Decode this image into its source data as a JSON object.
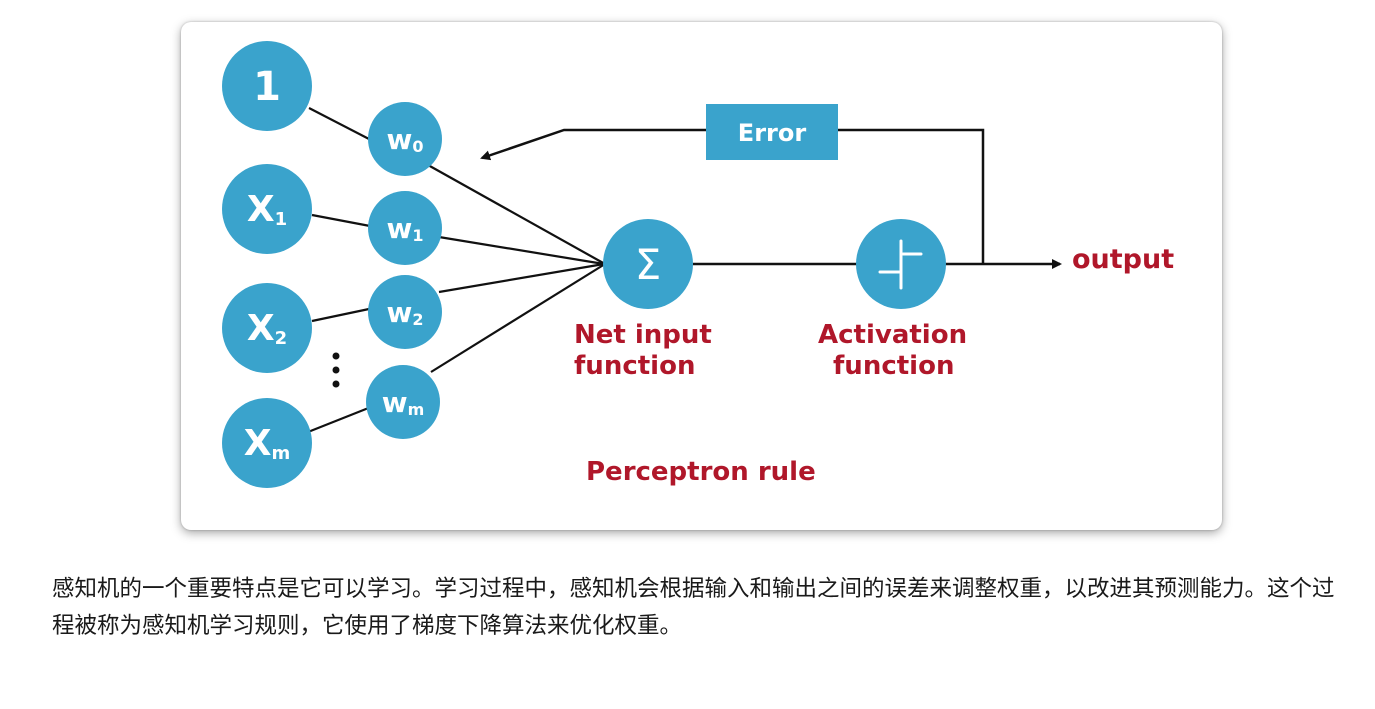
{
  "diagram": {
    "inputs": [
      {
        "id": "bias",
        "main": "1",
        "sub": ""
      },
      {
        "id": "x1",
        "main": "X",
        "sub": "1"
      },
      {
        "id": "x2",
        "main": "X",
        "sub": "2"
      },
      {
        "id": "xm",
        "main": "X",
        "sub": "m"
      }
    ],
    "weights": [
      {
        "id": "w0",
        "main": "w",
        "sub": "0"
      },
      {
        "id": "w1",
        "main": "w",
        "sub": "1"
      },
      {
        "id": "w2",
        "main": "w",
        "sub": "2"
      },
      {
        "id": "wm",
        "main": "w",
        "sub": "m"
      }
    ],
    "sum_symbol": "Σ",
    "error_label": "Error",
    "output_label": "output",
    "net_input_label": [
      "Net input",
      "function"
    ],
    "activation_label": [
      "Activation",
      "function"
    ],
    "rule_label": "Perceptron rule",
    "colors": {
      "node": "#3aa3cc",
      "error_box": "#3aa3cc",
      "label_red": "#b0172a",
      "lines": "#111111"
    }
  },
  "caption": "感知机的一个重要特点是它可以学习。学习过程中，感知机会根据输入和输出之间的误差来调整权重，以改进其预测能力。这个过程被称为感知机学习规则，它使用了梯度下降算法来优化权重。"
}
